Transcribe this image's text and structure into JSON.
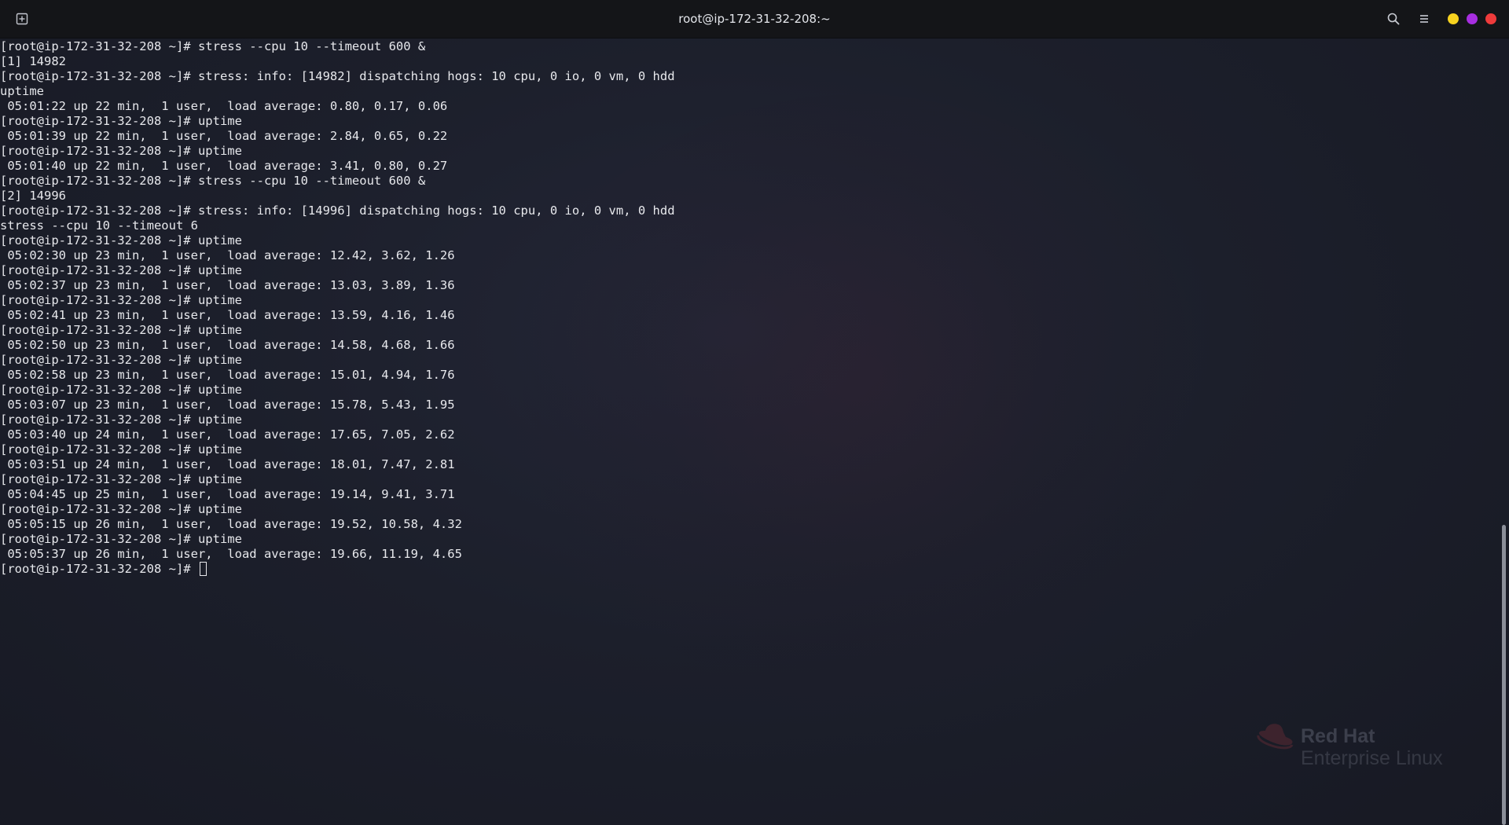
{
  "window": {
    "title": "root@ip-172-31-32-208:~",
    "colors": {
      "minimize": "#f7d21f",
      "maximize": "#a72ee0",
      "close": "#ef3b3b"
    }
  },
  "icons": {
    "new_tab": "new-tab-icon",
    "search": "search-icon",
    "menu": "hamburger-menu-icon"
  },
  "terminal": {
    "lines": [
      "[root@ip-172-31-32-208 ~]# stress --cpu 10 --timeout 600 &",
      "[1] 14982",
      "[root@ip-172-31-32-208 ~]# stress: info: [14982] dispatching hogs: 10 cpu, 0 io, 0 vm, 0 hdd",
      "uptime",
      " 05:01:22 up 22 min,  1 user,  load average: 0.80, 0.17, 0.06",
      "[root@ip-172-31-32-208 ~]# uptime",
      " 05:01:39 up 22 min,  1 user,  load average: 2.84, 0.65, 0.22",
      "[root@ip-172-31-32-208 ~]# uptime",
      " 05:01:40 up 22 min,  1 user,  load average: 3.41, 0.80, 0.27",
      "[root@ip-172-31-32-208 ~]# stress --cpu 10 --timeout 600 &",
      "[2] 14996",
      "[root@ip-172-31-32-208 ~]# stress: info: [14996] dispatching hogs: 10 cpu, 0 io, 0 vm, 0 hdd",
      "stress --cpu 10 --timeout 6",
      "[root@ip-172-31-32-208 ~]# uptime",
      " 05:02:30 up 23 min,  1 user,  load average: 12.42, 3.62, 1.26",
      "[root@ip-172-31-32-208 ~]# uptime",
      " 05:02:37 up 23 min,  1 user,  load average: 13.03, 3.89, 1.36",
      "[root@ip-172-31-32-208 ~]# uptime",
      " 05:02:41 up 23 min,  1 user,  load average: 13.59, 4.16, 1.46",
      "[root@ip-172-31-32-208 ~]# uptime",
      " 05:02:50 up 23 min,  1 user,  load average: 14.58, 4.68, 1.66",
      "[root@ip-172-31-32-208 ~]# uptime",
      " 05:02:58 up 23 min,  1 user,  load average: 15.01, 4.94, 1.76",
      "[root@ip-172-31-32-208 ~]# uptime",
      " 05:03:07 up 23 min,  1 user,  load average: 15.78, 5.43, 1.95",
      "[root@ip-172-31-32-208 ~]# uptime",
      " 05:03:40 up 24 min,  1 user,  load average: 17.65, 7.05, 2.62",
      "[root@ip-172-31-32-208 ~]# uptime",
      " 05:03:51 up 24 min,  1 user,  load average: 18.01, 7.47, 2.81",
      "[root@ip-172-31-32-208 ~]# uptime",
      " 05:04:45 up 25 min,  1 user,  load average: 19.14, 9.41, 3.71",
      "[root@ip-172-31-32-208 ~]# uptime",
      " 05:05:15 up 26 min,  1 user,  load average: 19.52, 10.58, 4.32",
      "[root@ip-172-31-32-208 ~]# uptime",
      " 05:05:37 up 26 min,  1 user,  load average: 19.66, 11.19, 4.65"
    ],
    "prompt": "[root@ip-172-31-32-208 ~]# "
  },
  "watermark": {
    "brand": "Red Hat",
    "product": "Enterprise Linux",
    "icon": "red-hat-logo-icon"
  }
}
